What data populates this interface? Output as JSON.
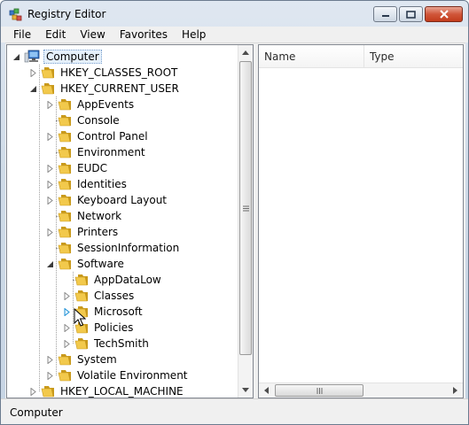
{
  "window": {
    "title": "Registry Editor"
  },
  "menu": [
    "File",
    "Edit",
    "View",
    "Favorites",
    "Help"
  ],
  "tree": {
    "nodes": [
      {
        "label": "Computer",
        "level": 0,
        "expander": "expanded",
        "icon": "computer-icon",
        "selected": true
      },
      {
        "label": "HKEY_CLASSES_ROOT",
        "level": 1,
        "expander": "collapsed",
        "icon": "folder-icon"
      },
      {
        "label": "HKEY_CURRENT_USER",
        "level": 1,
        "expander": "expanded",
        "icon": "folder-icon"
      },
      {
        "label": "AppEvents",
        "level": 2,
        "expander": "collapsed",
        "icon": "folder-icon"
      },
      {
        "label": "Console",
        "level": 2,
        "expander": "none",
        "icon": "folder-icon"
      },
      {
        "label": "Control Panel",
        "level": 2,
        "expander": "collapsed",
        "icon": "folder-icon"
      },
      {
        "label": "Environment",
        "level": 2,
        "expander": "none",
        "icon": "folder-icon"
      },
      {
        "label": "EUDC",
        "level": 2,
        "expander": "collapsed",
        "icon": "folder-icon"
      },
      {
        "label": "Identities",
        "level": 2,
        "expander": "collapsed",
        "icon": "folder-icon"
      },
      {
        "label": "Keyboard Layout",
        "level": 2,
        "expander": "collapsed",
        "icon": "folder-icon"
      },
      {
        "label": "Network",
        "level": 2,
        "expander": "none",
        "icon": "folder-icon"
      },
      {
        "label": "Printers",
        "level": 2,
        "expander": "collapsed",
        "icon": "folder-icon"
      },
      {
        "label": "SessionInformation",
        "level": 2,
        "expander": "none",
        "icon": "folder-icon"
      },
      {
        "label": "Software",
        "level": 2,
        "expander": "expanded",
        "icon": "folder-icon"
      },
      {
        "label": "AppDataLow",
        "level": 3,
        "expander": "none",
        "icon": "folder-icon"
      },
      {
        "label": "Classes",
        "level": 3,
        "expander": "collapsed",
        "icon": "folder-icon"
      },
      {
        "label": "Microsoft",
        "level": 3,
        "expander": "collapsed-hover",
        "icon": "folder-icon"
      },
      {
        "label": "Policies",
        "level": 3,
        "expander": "collapsed",
        "icon": "folder-icon"
      },
      {
        "label": "TechSmith",
        "level": 3,
        "expander": "collapsed",
        "icon": "folder-icon"
      },
      {
        "label": "System",
        "level": 2,
        "expander": "collapsed",
        "icon": "folder-icon"
      },
      {
        "label": "Volatile Environment",
        "level": 2,
        "expander": "collapsed",
        "icon": "folder-icon"
      },
      {
        "label": "HKEY_LOCAL_MACHINE",
        "level": 1,
        "expander": "collapsed",
        "icon": "folder-icon"
      }
    ]
  },
  "list": {
    "columns": [
      "Name",
      "Type"
    ]
  },
  "status": {
    "text": "Computer"
  },
  "colors": {
    "folder": "#f2c94c",
    "folder_dark": "#c99a1c",
    "selection": "#e5f0fb",
    "hover_arrow": "#1e90d6"
  }
}
